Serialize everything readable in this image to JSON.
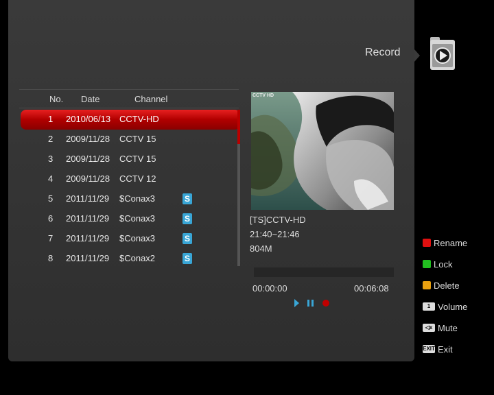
{
  "header": {
    "title": "Record",
    "icon": "record-folder-icon"
  },
  "list": {
    "columns": {
      "no": "No.",
      "date": "Date",
      "channel": "Channel"
    },
    "rows": [
      {
        "no": "1",
        "date": "2010/06/13",
        "channel": "CCTV-HD",
        "badge": "",
        "selected": true
      },
      {
        "no": "2",
        "date": "2009/11/28",
        "channel": "CCTV 15",
        "badge": ""
      },
      {
        "no": "3",
        "date": "2009/11/28",
        "channel": "CCTV 15",
        "badge": ""
      },
      {
        "no": "4",
        "date": "2009/11/28",
        "channel": "CCTV 12",
        "badge": ""
      },
      {
        "no": "5",
        "date": "2011/11/29",
        "channel": "$Conax3",
        "badge": "S"
      },
      {
        "no": "6",
        "date": "2011/11/29",
        "channel": "$Conax3",
        "badge": "S"
      },
      {
        "no": "7",
        "date": "2011/11/29",
        "channel": "$Conax3",
        "badge": "S"
      },
      {
        "no": "8",
        "date": "2011/11/29",
        "channel": "$Conax2",
        "badge": "S"
      }
    ]
  },
  "preview": {
    "watermark": "CCTV HD",
    "info_title": "[TS]CCTV-HD",
    "info_time": "21:40~21:46",
    "info_size": "804M"
  },
  "playback": {
    "time_start": "00:00:00",
    "time_end": "00:06:08",
    "progress": 0
  },
  "legend": [
    {
      "label": "Rename",
      "color": "#e01010",
      "icon": "red-key-icon"
    },
    {
      "label": "Lock",
      "color": "#22c020",
      "icon": "green-key-icon"
    },
    {
      "label": "Delete",
      "color": "#e8a010",
      "icon": "yellow-key-icon"
    },
    {
      "label": "Volume",
      "key": "1",
      "icon": "volume-key-icon"
    },
    {
      "label": "Mute",
      "key": "◁x",
      "icon": "mute-key-icon"
    },
    {
      "label": "Exit",
      "key": "EXIT",
      "icon": "exit-key-icon"
    }
  ],
  "colors": {
    "selected_row": "#c40000",
    "badge": "#39a6d6"
  }
}
